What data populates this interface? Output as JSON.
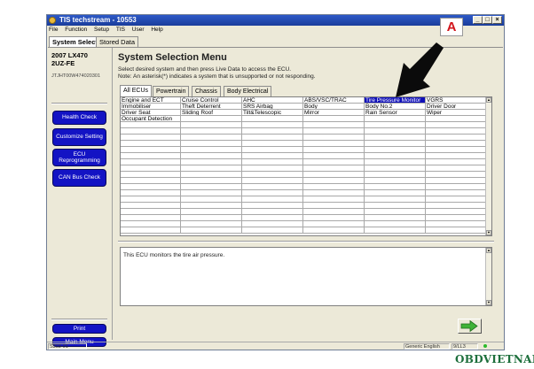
{
  "window": {
    "title": "TIS techstream - 10553",
    "controls": {
      "minimize": "_",
      "maximize": "□",
      "close": "×"
    }
  },
  "menubar": [
    "File",
    "Function",
    "Setup",
    "TIS",
    "User",
    "Help"
  ],
  "top_tabs": [
    "System Select",
    "Stored Data"
  ],
  "vehicle": {
    "model": "2007 LX470",
    "engine": "2UZ-FE",
    "vin": "JTJHT00W474020301"
  },
  "sidebar": {
    "buttons": [
      "Health Check",
      "Customize Setting",
      "ECU Reprogramming",
      "CAN Bus Check"
    ],
    "bottom_buttons": [
      "Print",
      "Main Menu"
    ]
  },
  "main": {
    "title": "System Selection Menu",
    "instruction": "Select desired system and then press Live Data to access the ECU.",
    "note": "Note: An asterisk(*) indicates a system that is unsupported or not responding."
  },
  "ecu_tabs": [
    "All ECUs",
    "Powertrain",
    "Chassis",
    "Body Electrical"
  ],
  "grid": {
    "rows": [
      [
        "Engine and ECT",
        "Cruise Control",
        "AHC",
        "ABS/VSC/TRAC",
        "Tire Pressure Monitor",
        "VGRS"
      ],
      [
        "Immobiliser",
        "Theft Deterrent",
        "SRS Airbag",
        "Body",
        "Body No.2",
        "Driver Door"
      ],
      [
        "Driver Seat",
        "Sliding Roof",
        "Tilt&Telescopic",
        "Mirror",
        "Rain Sensor",
        "Wiper"
      ],
      [
        "Occupant Detection",
        "",
        "",
        "",
        "",
        ""
      ]
    ],
    "selected": "Tire Pressure Monitor",
    "scroll_up_glyph": "▲",
    "scroll_down_glyph": "▼"
  },
  "description": "This ECU monitors the tire air pressure.",
  "statusbar": {
    "left": "S303-01",
    "language": "Generic English",
    "right": "9/LL3"
  },
  "annotation": {
    "label": "A",
    "color": "#d2141b"
  },
  "watermark": "OBDVIETNAM",
  "colors": {
    "accent_button": "#1313c4",
    "selection": "#1010b8",
    "titlebar": "#2d59c8"
  },
  "icons": {
    "app": "techstream-icon",
    "next": "green-arrow-right-icon",
    "pointer": "black-arrow-icon"
  }
}
